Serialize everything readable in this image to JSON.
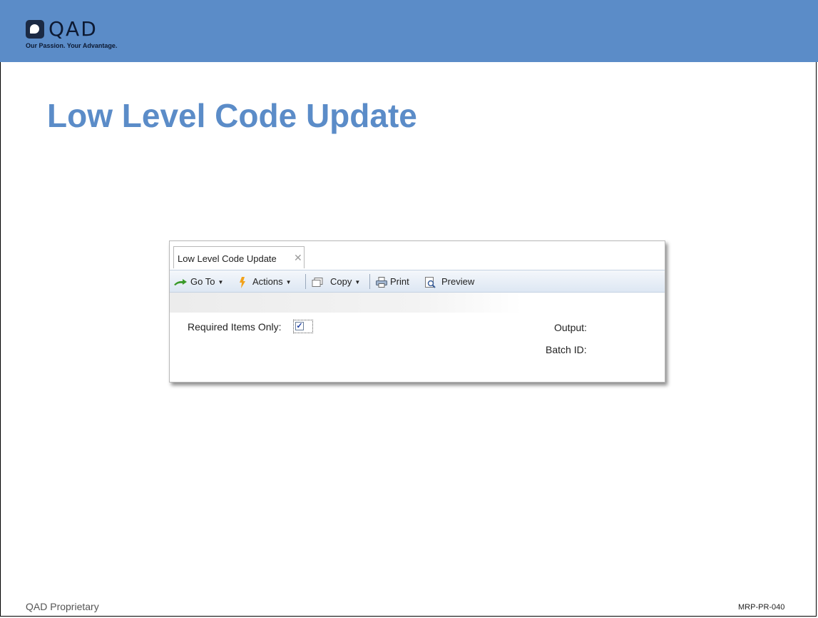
{
  "colors": {
    "banner": "#5b8cc8",
    "title": "#5b8cc8"
  },
  "logo": {
    "text": "QAD",
    "tagline": "Our Passion. Your Advantage."
  },
  "slide": {
    "title": "Low Level Code Update"
  },
  "window": {
    "tab": {
      "label": "Low Level Code Update",
      "close_icon": "close-icon"
    },
    "toolbar": {
      "goto": {
        "label": "Go To",
        "icon": "go-to-arrow-icon",
        "has_dropdown": true
      },
      "actions": {
        "label": "Actions",
        "icon": "actions-lightning-icon",
        "has_dropdown": true
      },
      "copy": {
        "label": "Copy",
        "icon": "copy-icon",
        "has_dropdown": true
      },
      "print": {
        "label": "Print",
        "icon": "printer-icon"
      },
      "preview": {
        "label": "Preview",
        "icon": "preview-icon"
      }
    },
    "form": {
      "required_items_only": {
        "label": "Required Items Only:",
        "checked": true
      },
      "output": {
        "label": "Output:"
      },
      "batch_id": {
        "label": "Batch ID:"
      }
    }
  },
  "footer": {
    "left": "QAD Proprietary",
    "right": "MRP-PR-040"
  }
}
